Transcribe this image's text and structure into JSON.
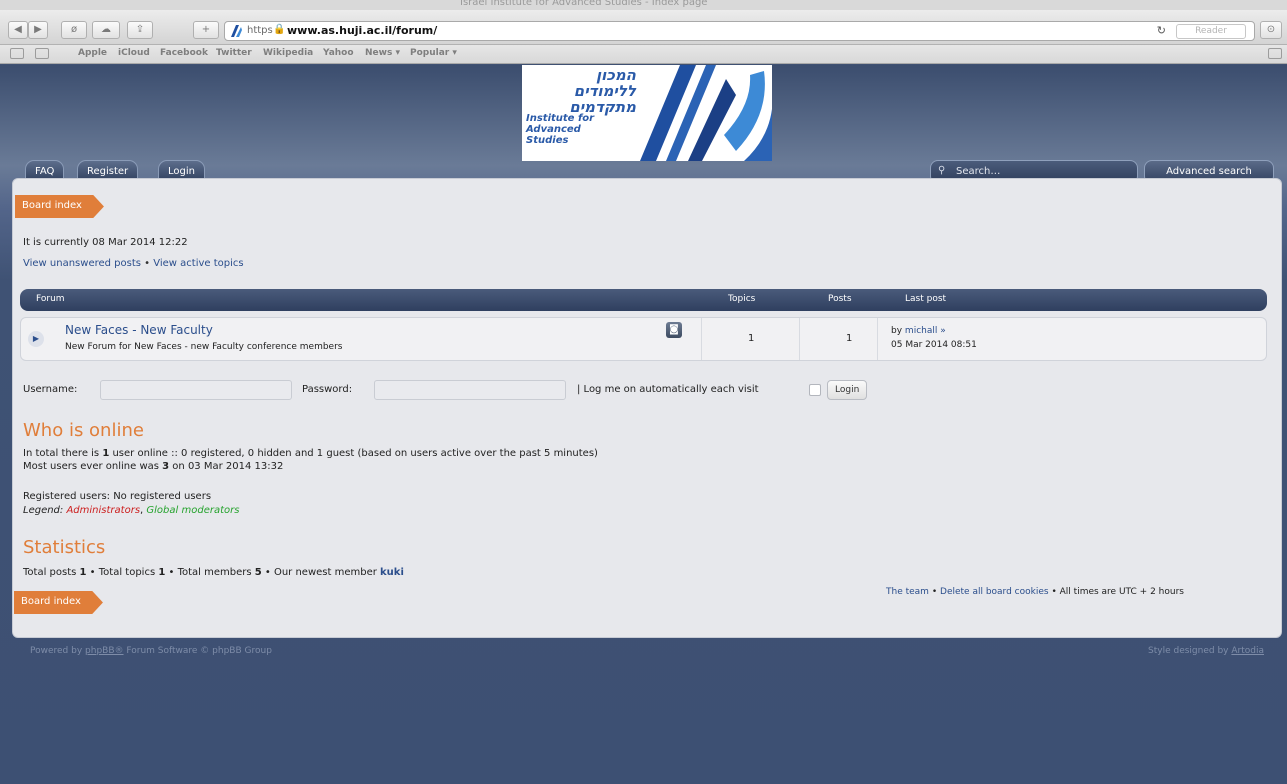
{
  "browser": {
    "window_title": "Israel Institute for Advanced Studies - Index page",
    "url_protocol": "https",
    "url_host": "www.as.huji.ac.il/forum/",
    "reader_label": "Reader",
    "bookmarks": [
      "Apple",
      "iCloud",
      "Facebook",
      "Twitter",
      "Wikipedia",
      "Yahoo",
      "News ▾",
      "Popular ▾"
    ]
  },
  "logo": {
    "hebrew_lines": [
      "המכון",
      "ללימודים",
      "מתקדמים"
    ],
    "english_lines": [
      "Institute for",
      "Advanced",
      "Studies"
    ]
  },
  "nav": {
    "faq": "FAQ",
    "register": "Register",
    "login": "Login",
    "search_placeholder": "Search…",
    "advanced_search": "Advanced search"
  },
  "breadcrumb": {
    "board_index": "Board index"
  },
  "status": {
    "current_time": "It is currently 08 Mar 2014 12:22",
    "view_unanswered": "View unanswered posts",
    "bullet": "•",
    "view_active": "View active topics"
  },
  "forum_table": {
    "headers": {
      "forum": "Forum",
      "topics": "Topics",
      "posts": "Posts",
      "last_post": "Last post"
    },
    "rows": [
      {
        "title": "New Faces - New Faculty",
        "description": "New Forum for New Faces - new Faculty conference members",
        "topics": "1",
        "posts": "1",
        "last_post_by": "by",
        "last_post_user": "michall",
        "last_post_date": "05 Mar 2014 08:51"
      }
    ]
  },
  "login_form": {
    "username_label": "Username:",
    "password_label": "Password:",
    "remember_label": "| Log me on automatically each visit",
    "login_button": "Login"
  },
  "who_is_online": {
    "heading": "Who is online",
    "line1_pre": "In total there is ",
    "line1_count": "1",
    "line1_post": " user online :: 0 registered, 0 hidden and 1 guest (based on users active over the past 5 minutes)",
    "line2_pre": "Most users ever online was ",
    "line2_count": "3",
    "line2_post": " on 03 Mar 2014 13:32",
    "registered_users": "Registered users: No registered users",
    "legend_label": "Legend:",
    "legend_admins": "Administrators",
    "legend_comma": ",",
    "legend_globalmods": "Global moderators"
  },
  "statistics": {
    "heading": "Statistics",
    "total_posts_label": "Total posts ",
    "total_posts": "1",
    "total_topics_label": " • Total topics ",
    "total_topics": "1",
    "total_members_label": " • Total members ",
    "total_members": "5",
    "newest_label": " • Our newest member ",
    "newest_member": "kuki"
  },
  "footer_links": {
    "team": "The team",
    "delete_cookies": "Delete all board cookies",
    "timezone": "All times are UTC + 2 hours"
  },
  "page_footer": {
    "powered_pre": "Powered by ",
    "phpbb": "phpBB®",
    "powered_post": " Forum Software © phpBB Group",
    "style_pre": "Style designed by ",
    "style_author": "Artodia"
  },
  "colors": {
    "accent_orange": "#e07e3a",
    "nav_blue": "#3f5274",
    "link_blue": "#2b4e8c",
    "admin_red": "#cc1f1f",
    "globalmod_green": "#27a32f"
  },
  "icons": [
    "back-arrow-icon",
    "forward-arrow-icon",
    "reader-icon",
    "share-icon",
    "cloud-icon",
    "add-tab-icon",
    "reload-icon",
    "search-icon",
    "rss-feed-icon",
    "forum-arrow-icon"
  ]
}
